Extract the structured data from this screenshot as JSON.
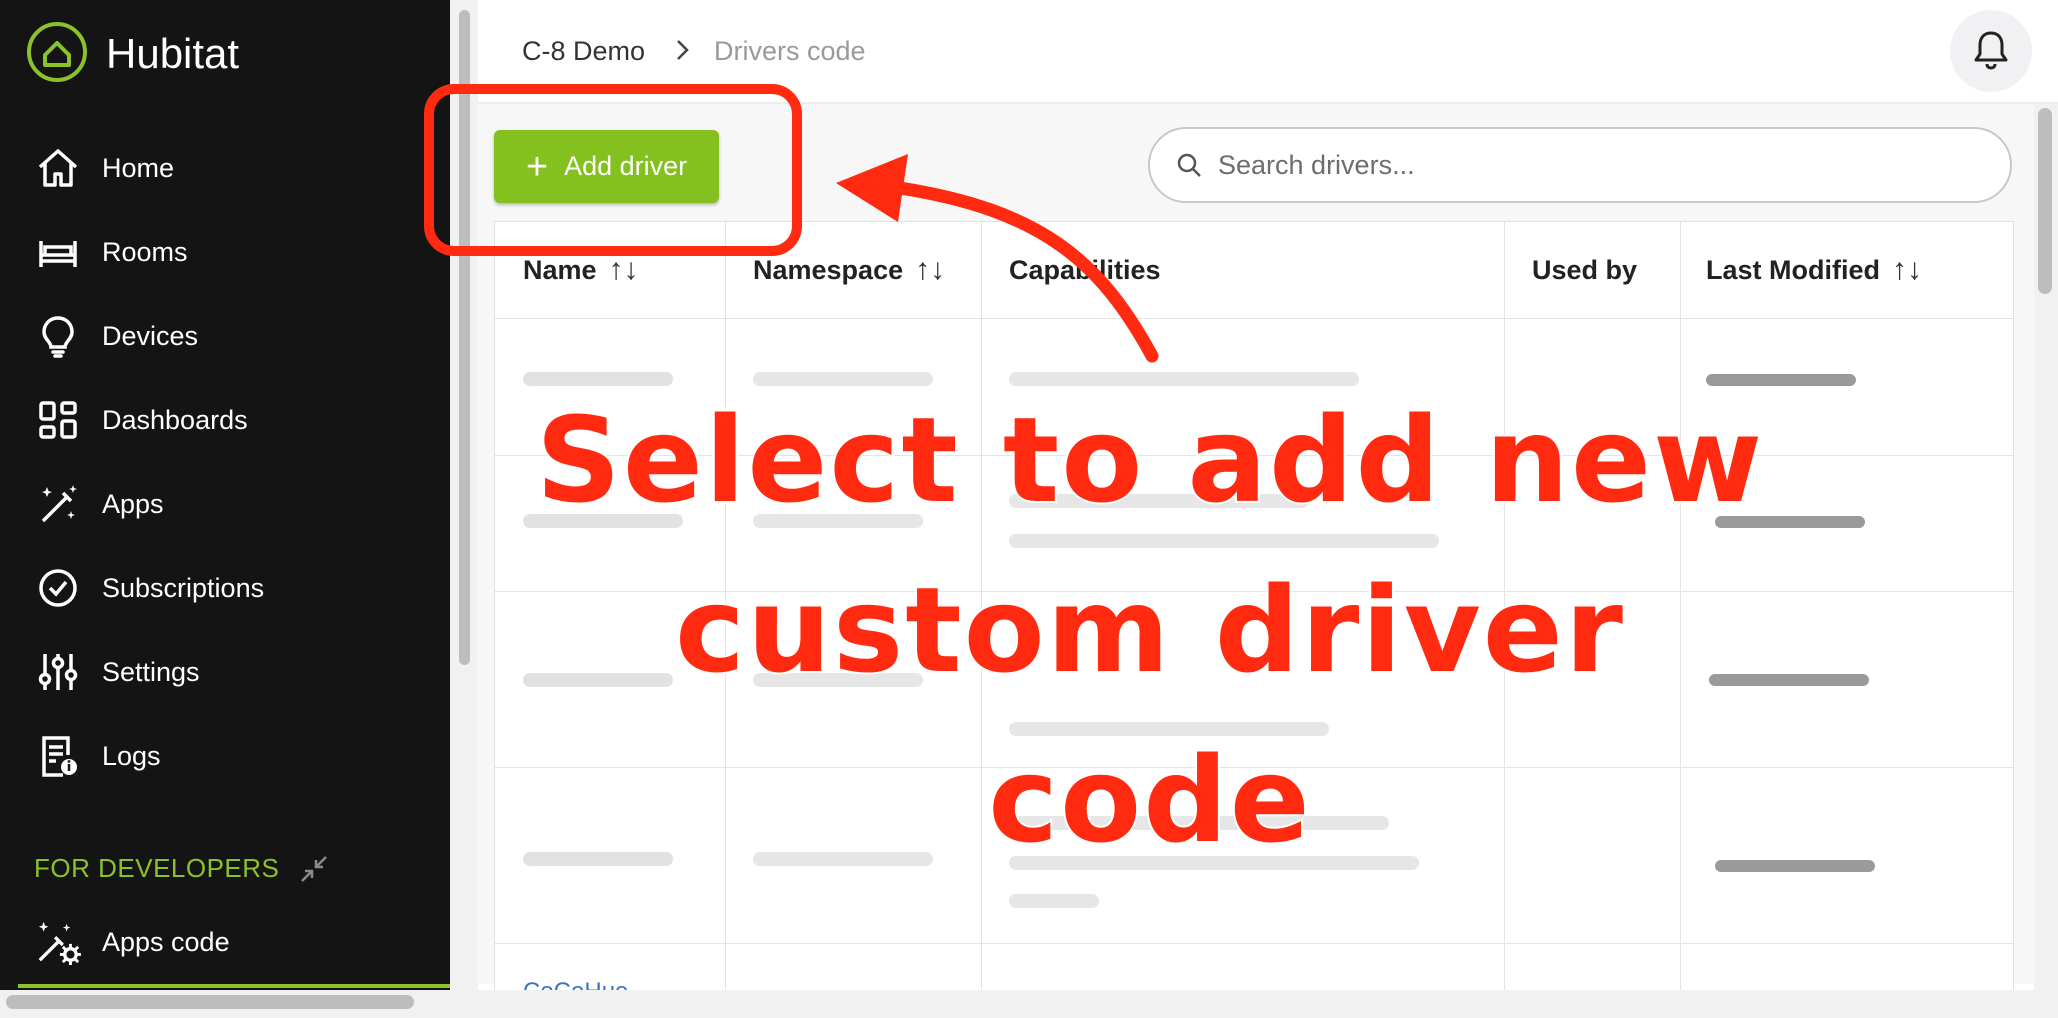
{
  "app": {
    "title": "Hubitat"
  },
  "sidebar": {
    "items": [
      {
        "label": "Home",
        "icon": "home-icon"
      },
      {
        "label": "Rooms",
        "icon": "bed-icon"
      },
      {
        "label": "Devices",
        "icon": "lightbulb-icon"
      },
      {
        "label": "Dashboards",
        "icon": "dashboard-grid-icon"
      },
      {
        "label": "Apps",
        "icon": "magic-wand-icon"
      },
      {
        "label": "Subscriptions",
        "icon": "check-circle-icon"
      },
      {
        "label": "Settings",
        "icon": "sliders-icon"
      },
      {
        "label": "Logs",
        "icon": "log-document-icon"
      }
    ],
    "developer_section": {
      "label": "FOR DEVELOPERS",
      "collapse_icon": "collapse-arrows-icon"
    },
    "developer_items": [
      {
        "label": "Apps code",
        "icon": "wand-gear-icon"
      }
    ]
  },
  "header": {
    "breadcrumb": [
      "C-8 Demo",
      "Drivers code"
    ],
    "notification_icon": "bell-icon"
  },
  "toolbar": {
    "add_button_label": "Add driver",
    "search_placeholder": "Search drivers..."
  },
  "table": {
    "columns": [
      {
        "label": "Name",
        "sortable": true
      },
      {
        "label": "Namespace",
        "sortable": true
      },
      {
        "label": "Capabilities",
        "sortable": false
      },
      {
        "label": "Used by",
        "sortable": false
      },
      {
        "label": "Last Modified",
        "sortable": true
      }
    ],
    "partial_row_name": "CoCoHue"
  },
  "annotation": {
    "lines": [
      "Select to add new",
      "custom driver",
      "code"
    ]
  },
  "colors": {
    "accent_green": "#84c01e",
    "sidebar_bg": "#141414",
    "annotation_red": "#ff2a10"
  }
}
